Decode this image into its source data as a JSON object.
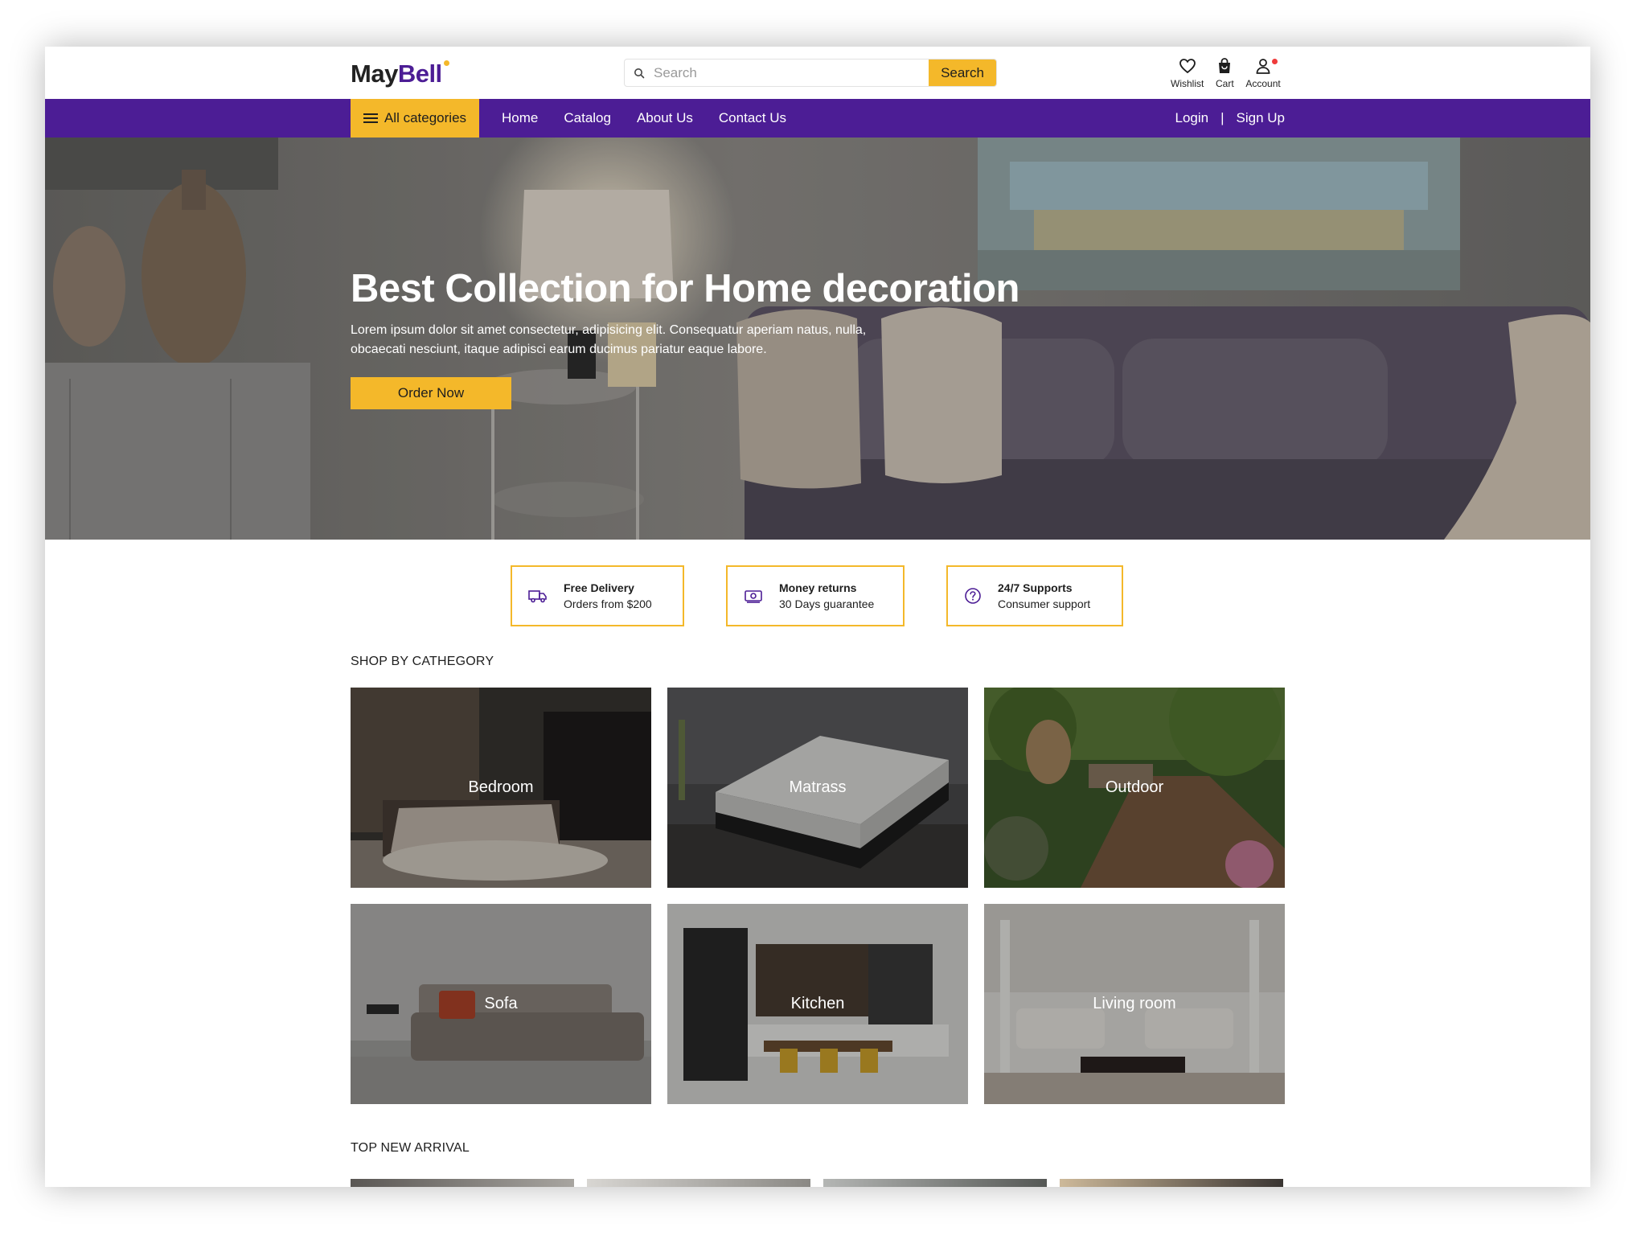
{
  "brand": {
    "name_part1": "May",
    "name_part2": "Bell",
    "accent": "#4c1d95",
    "highlight": "#f4b82a"
  },
  "search": {
    "placeholder": "Search",
    "button": "Search",
    "value": ""
  },
  "header_icons": [
    {
      "icon": "heart-icon",
      "label": "Wishlist"
    },
    {
      "icon": "bag-icon",
      "label": "Cart"
    },
    {
      "icon": "user-icon",
      "label": "Account"
    }
  ],
  "nav": {
    "all_categories": "All categories",
    "links": [
      "Home",
      "Catalog",
      "About Us",
      "Contact Us"
    ],
    "login": "Login",
    "separator": "|",
    "signup": "Sign Up"
  },
  "hero": {
    "title": "Best Collection for Home decoration",
    "text": "Lorem ipsum dolor sit amet consectetur, adipisicing elit. Consequatur aperiam natus, nulla, obcaecati nesciunt, itaque adipisci earum ducimus pariatur eaque labore.",
    "button": "Order Now"
  },
  "features": [
    {
      "icon": "truck-icon",
      "title": "Free Delivery",
      "subtitle": "Orders from $200"
    },
    {
      "icon": "money-icon",
      "title": "Money returns",
      "subtitle": "30 Days guarantee"
    },
    {
      "icon": "help-icon",
      "title": "24/7 Supports",
      "subtitle": "Consumer support"
    }
  ],
  "categories": {
    "heading": "SHOP BY CATHEGORY",
    "items": [
      "Bedroom",
      "Matrass",
      "Outdoor",
      "Sofa",
      "Kitchen",
      "Living room"
    ]
  },
  "arrivals": {
    "heading": "TOP NEW ARRIVAL"
  }
}
